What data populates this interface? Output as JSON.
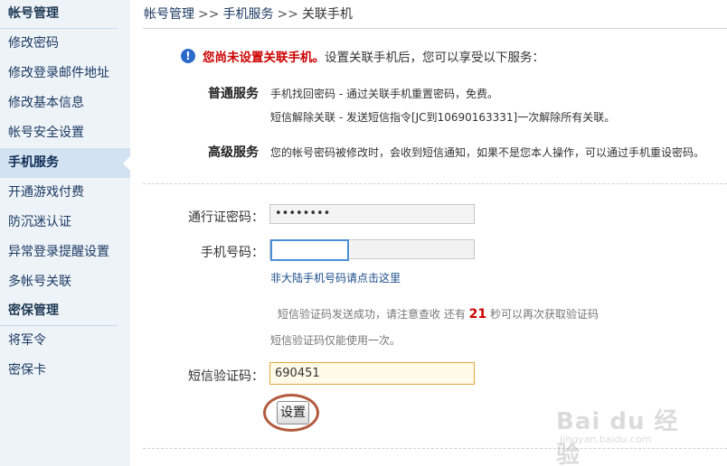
{
  "sidebar": {
    "section1": "帐号管理",
    "items1": [
      "修改密码",
      "修改登录邮件地址",
      "修改基本信息",
      "帐号安全设置",
      "手机服务",
      "开通游戏付费",
      "防沉迷认证",
      "异常登录提醒设置",
      "多帐号关联"
    ],
    "active_item": "手机服务",
    "section2": "密保管理",
    "items2": [
      "将军令",
      "密保卡"
    ]
  },
  "breadcrumb": {
    "items": [
      "帐号管理",
      "手机服务",
      "关联手机"
    ],
    "separator": ">>"
  },
  "notice": {
    "warning": "您尚未设置关联手机。",
    "text": "设置关联手机后，您可以享受以下服务："
  },
  "services": {
    "normal_label": "普通服务",
    "normal_line1": "手机找回密码 - 通过关联手机重置密码，免费。",
    "normal_line2": "短信解除关联 - 发送短信指令[JC到10690163331]一次解除所有关联。",
    "advanced_label": "高级服务",
    "advanced_line1": "您的帐号密码被修改时，会收到短信通知，如果不是您本人操作，可以通过手机重设密码。"
  },
  "form": {
    "password_label": "通行证密码：",
    "password_value": "••••••••",
    "phone_label": "手机号码：",
    "phone_value": "",
    "overseas_link": "非大陆手机号码请点击这里",
    "sms_sent_prefix": "短信验证码发送成功，请注意查收 还有",
    "sms_countdown": "21",
    "sms_sent_suffix": "秒可以再次获取验证码",
    "sms_once": "短信验证码仅能使用一次。",
    "sms_label": "短信验证码：",
    "sms_value": "690451",
    "submit_label": "设置"
  },
  "watermark": {
    "text": "Bai du 经验",
    "sub": "jingyan.baidu.com"
  }
}
